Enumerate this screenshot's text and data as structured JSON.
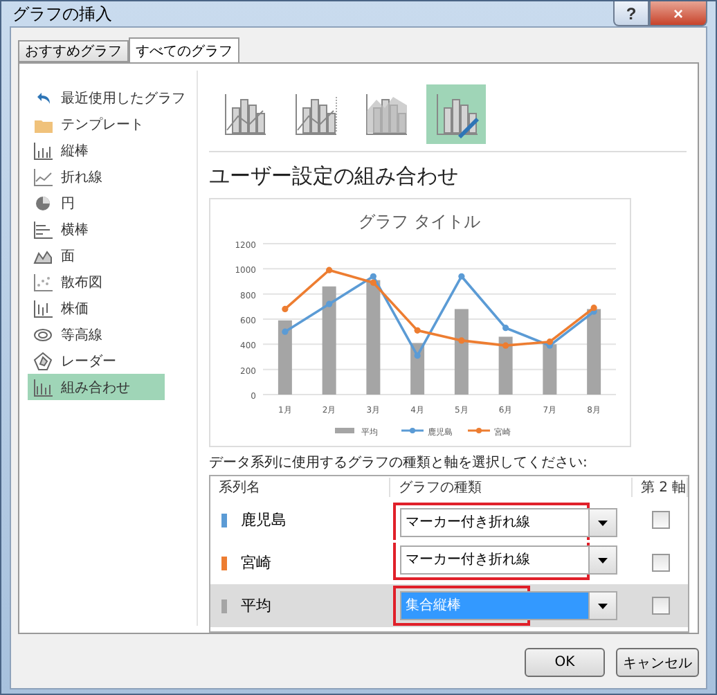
{
  "window": {
    "title": "グラフの挿入",
    "help": "?",
    "close": "×"
  },
  "tabs": [
    {
      "label": "おすすめグラフ",
      "selected": false
    },
    {
      "label": "すべてのグラフ",
      "selected": true
    }
  ],
  "sidebar": {
    "items": [
      {
        "label": "最近使用したグラフ",
        "selected": false
      },
      {
        "label": "テンプレート",
        "selected": false
      },
      {
        "label": "縦棒",
        "selected": false
      },
      {
        "label": "折れ線",
        "selected": false
      },
      {
        "label": "円",
        "selected": false
      },
      {
        "label": "横棒",
        "selected": false
      },
      {
        "label": "面",
        "selected": false
      },
      {
        "label": "散布図",
        "selected": false
      },
      {
        "label": "株価",
        "selected": false
      },
      {
        "label": "等高線",
        "selected": false
      },
      {
        "label": "レーダー",
        "selected": false
      },
      {
        "label": "組み合わせ",
        "selected": true
      }
    ]
  },
  "subtypes": [
    {
      "selected": false
    },
    {
      "selected": false
    },
    {
      "selected": false
    },
    {
      "selected": true
    }
  ],
  "heading": "ユーザー設定の組み合わせ",
  "chart_data": {
    "type": "bar",
    "title": "グラフ タイトル",
    "categories": [
      "1月",
      "2月",
      "3月",
      "4月",
      "5月",
      "6月",
      "7月",
      "8月"
    ],
    "series": [
      {
        "name": "平均",
        "color": "#a5a5a5",
        "values": [
          590,
          860,
          910,
          410,
          680,
          460,
          400,
          680
        ]
      },
      {
        "name": "鹿児島",
        "color": "#5b9bd5",
        "type": "line",
        "marker": true,
        "values": [
          500,
          720,
          940,
          310,
          940,
          530,
          390,
          660
        ]
      },
      {
        "name": "宮崎",
        "color": "#ed7d31",
        "type": "line",
        "marker": true,
        "values": [
          680,
          990,
          890,
          510,
          430,
          390,
          420,
          690
        ]
      }
    ],
    "ylim": [
      0,
      1200
    ],
    "grid": true,
    "legend": "bottom",
    "yticks": [
      0,
      200,
      400,
      600,
      800,
      1000,
      1200
    ]
  },
  "instruction": "データ系列に使用するグラフの種類と軸を選択してください:",
  "series_table": {
    "columns": [
      "系列名",
      "グラフの種類",
      "第 2 軸"
    ],
    "rows": [
      {
        "name": "鹿児島",
        "color": "#5b9bd5",
        "type": "マーカー付き折れ線",
        "secondary_axis": false,
        "selected": false,
        "highlighted": true
      },
      {
        "name": "宮崎",
        "color": "#ed7d31",
        "type": "マーカー付き折れ線",
        "secondary_axis": false,
        "selected": false,
        "highlighted": true
      },
      {
        "name": "平均",
        "color": "#a5a5a5",
        "type": "集合縦棒",
        "secondary_axis": false,
        "selected": true,
        "highlighted": true
      }
    ]
  },
  "buttons": [
    "OK",
    "キャンセル"
  ]
}
